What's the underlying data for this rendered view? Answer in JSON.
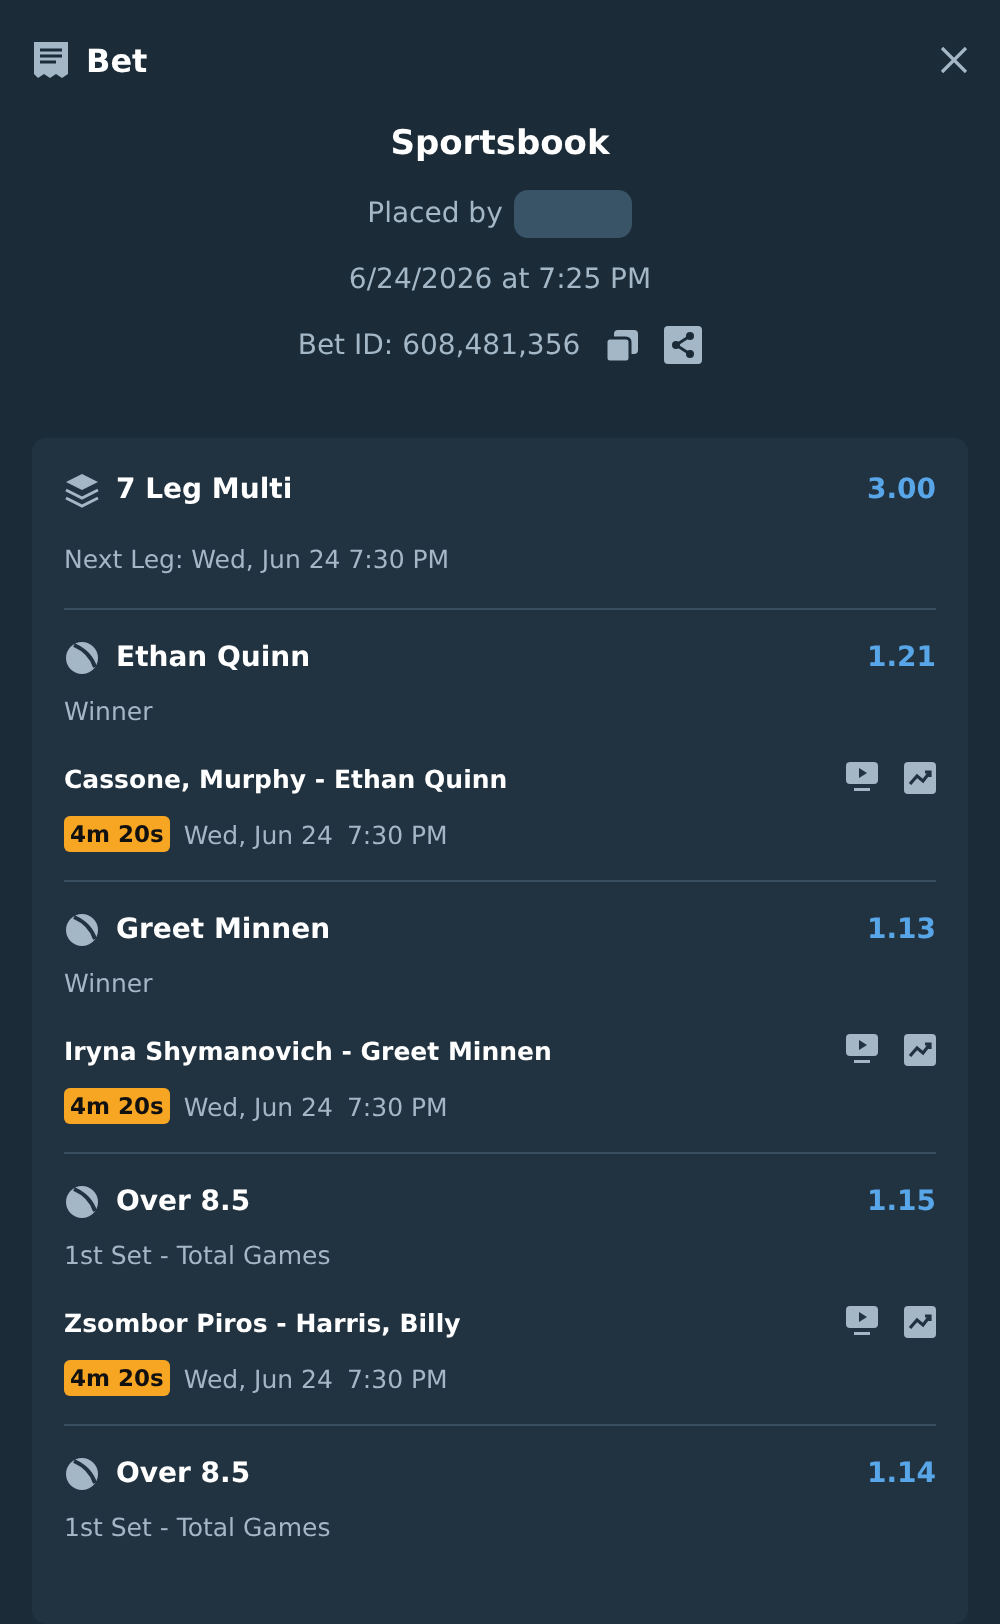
{
  "header": {
    "title": "Bet"
  },
  "summary": {
    "book": "Sportsbook",
    "placed_by": "Placed by",
    "placed_at": "6/24/2026 at 7:25 PM",
    "bet_id": "Bet ID: 608,481,356"
  },
  "multi": {
    "title": "7 Leg Multi",
    "odds": "3.00",
    "next_leg": "Next Leg: Wed, Jun 24 7:30 PM"
  },
  "legs": [
    {
      "selection": "Ethan Quinn",
      "odds": "1.21",
      "market": "Winner",
      "match": "Cassone, Murphy - Ethan Quinn",
      "countdown": "4m 20s",
      "date": "Wed, Jun 24",
      "time": "7:30 PM"
    },
    {
      "selection": "Greet Minnen",
      "odds": "1.13",
      "market": "Winner",
      "match": "Iryna Shymanovich - Greet Minnen",
      "countdown": "4m 20s",
      "date": "Wed, Jun 24",
      "time": "7:30 PM"
    },
    {
      "selection": "Over 8.5",
      "odds": "1.15",
      "market": "1st Set - Total Games",
      "match": "Zsombor Piros - Harris, Billy",
      "countdown": "4m 20s",
      "date": "Wed, Jun 24",
      "time": "7:30 PM"
    },
    {
      "selection": "Over 8.5",
      "odds": "1.14",
      "market": "1st Set - Total Games"
    }
  ]
}
